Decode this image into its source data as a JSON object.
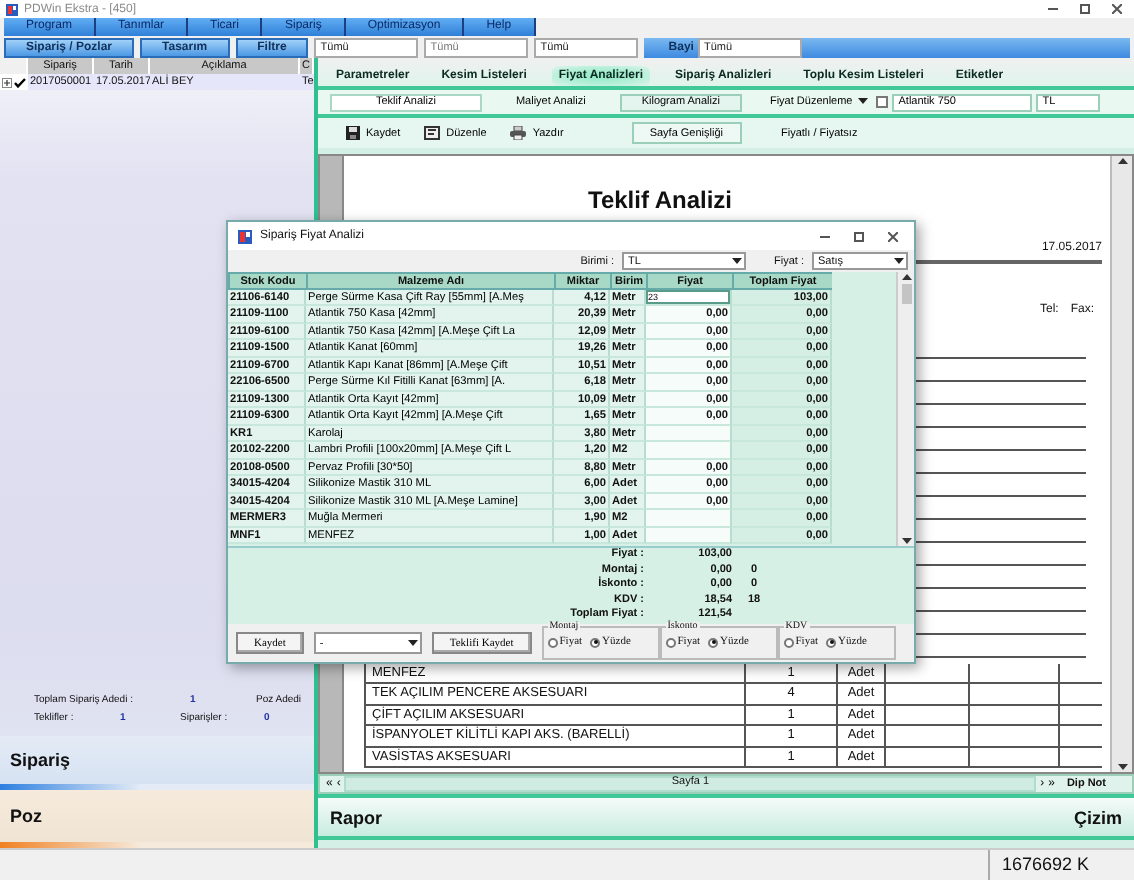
{
  "window": {
    "title": "PDWin Ekstra - [450]"
  },
  "menu": [
    "Program",
    "Tanımlar",
    "Ticari",
    "Sipariş",
    "Optimizasyon",
    "Help"
  ],
  "filter_bar": {
    "buttons": [
      "Sipariş / Pozlar",
      "Tasarım",
      "Filtre"
    ],
    "fields": [
      "Tümü",
      "Tümü",
      "Tümü"
    ],
    "bayi_label": "Bayi",
    "bayi_value": "Tümü"
  },
  "order_list": {
    "columns": [
      "Sipariş",
      "Tarih",
      "Açıklama",
      "C"
    ],
    "rows": [
      {
        "expanded": false,
        "checked": true,
        "cells": [
          "2017050001",
          "17.05.2017",
          "ALİ BEY",
          "Te"
        ]
      }
    ]
  },
  "summary": [
    [
      {
        "label": "Toplam Sipariş Adedi :",
        "value": "1"
      },
      {
        "label": "Poz Adedi"
      }
    ],
    [
      {
        "label": "Teklifler :",
        "value": "1"
      },
      {
        "label": "Siparişler :",
        "value": "0"
      }
    ]
  ],
  "left_sections": [
    "Sipariş",
    "Poz"
  ],
  "tabs": [
    {
      "label": "Parametreler",
      "selected": false
    },
    {
      "label": "Kesim Listeleri",
      "selected": false
    },
    {
      "label": "Fiyat Analizleri",
      "selected": true
    },
    {
      "label": "Sipariş Analizleri",
      "selected": false
    },
    {
      "label": "Toplu Kesim Listeleri",
      "selected": false
    },
    {
      "label": "Etiketler",
      "selected": false
    }
  ],
  "sub_tabs": [
    {
      "label": "Teklif Analizi",
      "selected": true
    },
    {
      "label": "Maliyet Analizi",
      "selected": false
    },
    {
      "label": "Kilogram Analizi",
      "selected": false
    }
  ],
  "price_edit": {
    "label": "Fiyat Düzenleme",
    "checked": false,
    "profile": "Atlantik 750",
    "currency": "TL"
  },
  "toolbar": [
    {
      "label": "Kaydet",
      "kind": "save"
    },
    {
      "label": "Düzenle",
      "kind": "edit"
    },
    {
      "label": "Yazdır",
      "kind": "print"
    },
    {
      "label": "Sayfa Genişliği",
      "kind": "boxed"
    },
    {
      "label": "Fiyatlı / Fiyatsız",
      "kind": "plain"
    }
  ],
  "report": {
    "title": "Teklif Analizi",
    "date": "17.05.2017",
    "tel": "Tel:",
    "fax": "Fax:",
    "rows": [
      {
        "name": "MENFEZ",
        "qty": "1",
        "unit": "Adet"
      },
      {
        "name": "TEK AÇILIM PENCERE AKSESUARI",
        "qty": "4",
        "unit": "Adet"
      },
      {
        "name": "ÇİFT AÇILIM AKSESUARI",
        "qty": "1",
        "unit": "Adet"
      },
      {
        "name": "İSPANYOLET KİLİTLİ KAPI AKS. (BARELLİ)",
        "qty": "1",
        "unit": "Adet"
      },
      {
        "name": "VASİSTAS AKSESUARI",
        "qty": "1",
        "unit": "Adet"
      }
    ],
    "pager": {
      "prev": [
        "«",
        "‹"
      ],
      "page": "Sayfa 1",
      "next": [
        "›",
        "»"
      ],
      "note": "Dip Not"
    }
  },
  "bottom_sections": [
    "Rapor",
    "Çizim"
  ],
  "dialog": {
    "title": "Sipariş Fiyat Analizi",
    "unit_label": "Birimi :",
    "unit": "TL",
    "price_label": "Fiyat :",
    "price_type": "Satış",
    "columns": [
      "Stok Kodu",
      "Malzeme Adı",
      "Miktar",
      "Birim",
      "Fiyat",
      "Toplam Fiyat"
    ],
    "rows": [
      {
        "code": "21106-6140",
        "name": "Perge Sürme Kasa Çift Ray [55mm] [A.Meş",
        "qty": "4,12",
        "unit": "Metr",
        "price": "23",
        "total": "103,00",
        "editing": true
      },
      {
        "code": "21109-1100",
        "name": "Atlantik 750 Kasa [42mm]",
        "qty": "20,39",
        "unit": "Metr",
        "price": "0,00",
        "total": "0,00",
        "editing": false
      },
      {
        "code": "21109-6100",
        "name": "Atlantik 750 Kasa [42mm] [A.Meşe Çift La",
        "qty": "12,09",
        "unit": "Metr",
        "price": "0,00",
        "total": "0,00",
        "editing": false
      },
      {
        "code": "21109-1500",
        "name": "Atlantik Kanat [60mm]",
        "qty": "19,26",
        "unit": "Metr",
        "price": "0,00",
        "total": "0,00",
        "editing": false
      },
      {
        "code": "21109-6700",
        "name": "Atlantik Kapı Kanat [86mm] [A.Meşe Çift",
        "qty": "10,51",
        "unit": "Metr",
        "price": "0,00",
        "total": "0,00",
        "editing": false
      },
      {
        "code": "22106-6500",
        "name": "Perge Sürme Kıl Fitilli Kanat [63mm] [A.",
        "qty": "6,18",
        "unit": "Metr",
        "price": "0,00",
        "total": "0,00",
        "editing": false
      },
      {
        "code": "21109-1300",
        "name": "Atlantik Orta Kayıt [42mm]",
        "qty": "10,09",
        "unit": "Metr",
        "price": "0,00",
        "total": "0,00",
        "editing": false
      },
      {
        "code": "21109-6300",
        "name": "Atlantik Orta Kayıt [42mm] [A.Meşe Çift",
        "qty": "1,65",
        "unit": "Metr",
        "price": "0,00",
        "total": "0,00",
        "editing": false
      },
      {
        "code": "KR1",
        "name": "Karolaj",
        "qty": "3,80",
        "unit": "Metr",
        "total": "0,00",
        "editing": false
      },
      {
        "code": "20102-2200",
        "name": "Lambri Profili [100x20mm] [A.Meşe Çift L",
        "qty": "1,20",
        "unit": "M2",
        "total": "0,00",
        "editing": false
      },
      {
        "code": "20108-0500",
        "name": "Pervaz Profili [30*50]",
        "qty": "8,80",
        "unit": "Metr",
        "price": "0,00",
        "total": "0,00",
        "editing": false
      },
      {
        "code": "34015-4204",
        "name": "Silikonize Mastik 310 ML",
        "qty": "6,00",
        "unit": "Adet",
        "price": "0,00",
        "total": "0,00",
        "editing": false
      },
      {
        "code": "34015-4204",
        "name": "Silikonize Mastik 310 ML [A.Meşe Lamine]",
        "qty": "3,00",
        "unit": "Adet",
        "price": "0,00",
        "total": "0,00",
        "editing": false
      },
      {
        "code": "MERMER3",
        "name": "Muğla Mermeri",
        "qty": "1,90",
        "unit": "M2",
        "total": "0,00",
        "editing": false
      },
      {
        "code": "MNF1",
        "name": "MENFEZ",
        "qty": "1,00",
        "unit": "Adet",
        "total": "0,00",
        "editing": false
      }
    ],
    "totals": [
      {
        "label": "Fiyat :",
        "value": "103,00"
      },
      {
        "label": "Montaj :",
        "value": "0,00",
        "extra": "0"
      },
      {
        "label": "İskonto :",
        "value": "0,00",
        "extra": "0"
      },
      {
        "label": "KDV :",
        "value": "18,54",
        "extra": "18"
      },
      {
        "label": "Toplam Fiyat :",
        "value": "121,54"
      }
    ],
    "save": "Kaydet",
    "template": "-",
    "save_offer": "Teklifi Kaydet",
    "options": [
      {
        "title": "Montaj",
        "choices": [
          {
            "label": "Fiyat",
            "selected": false
          },
          {
            "label": "Yüzde",
            "selected": true
          }
        ]
      },
      {
        "title": "İskonto",
        "choices": [
          {
            "label": "Fiyat",
            "selected": false
          },
          {
            "label": "Yüzde",
            "selected": true
          }
        ]
      },
      {
        "title": "KDV",
        "choices": [
          {
            "label": "Fiyat",
            "selected": false
          },
          {
            "label": "Yüzde",
            "selected": true
          }
        ]
      }
    ]
  },
  "status_bar": {
    "memory": "1676692 K"
  }
}
